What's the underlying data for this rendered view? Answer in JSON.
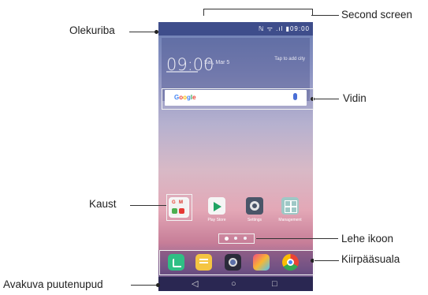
{
  "labels": {
    "second_screen": "Second screen",
    "status_bar": "Olekuriba",
    "widget": "Vidin",
    "folder": "Kaust",
    "page_icon": "Lehe ikoon",
    "quick_access": "Kiirpääsuala",
    "home_touch_buttons": "Avakuva puutenupud"
  },
  "phone": {
    "status": {
      "icons": "ℕ ᯤ .ıl ▮",
      "time": "09:00"
    },
    "clock": {
      "time": "09:00",
      "date": "Sat, Mar 5",
      "tap_text": "Tap to add city"
    },
    "search": {
      "brand": "Google"
    },
    "apps": [
      "Play Store",
      "Settings",
      "Management"
    ]
  },
  "colors": {
    "statusbar": "#3e4d8b",
    "navbar": "#2a2752"
  }
}
